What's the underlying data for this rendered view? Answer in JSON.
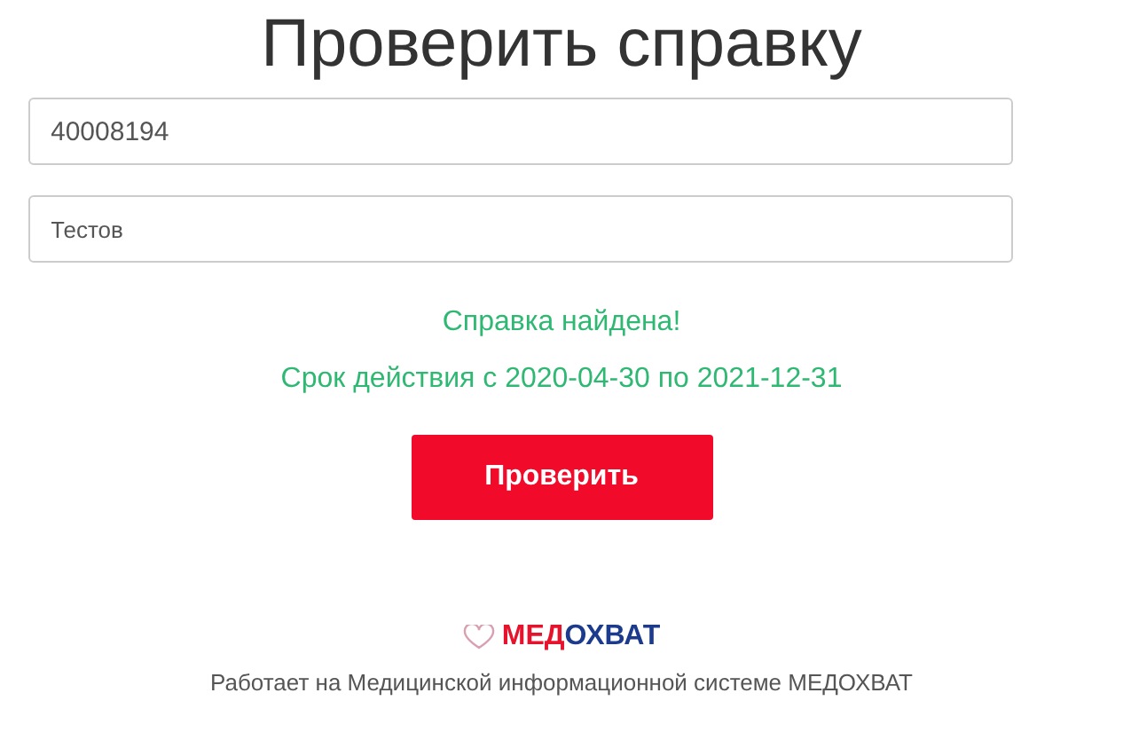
{
  "title": "Проверить справку",
  "fields": [
    {
      "value": "40008194"
    },
    {
      "value": "Тестов"
    }
  ],
  "result": {
    "status": "Справка найдена!",
    "validity": "Срок действия с 2020-04-30 по 2021-12-31"
  },
  "button": "Проверить",
  "logo": {
    "first": "МЕД",
    "second": "ОХВАТ"
  },
  "footer": "Работает на Медицинской информационной системе МЕДОХВАТ"
}
